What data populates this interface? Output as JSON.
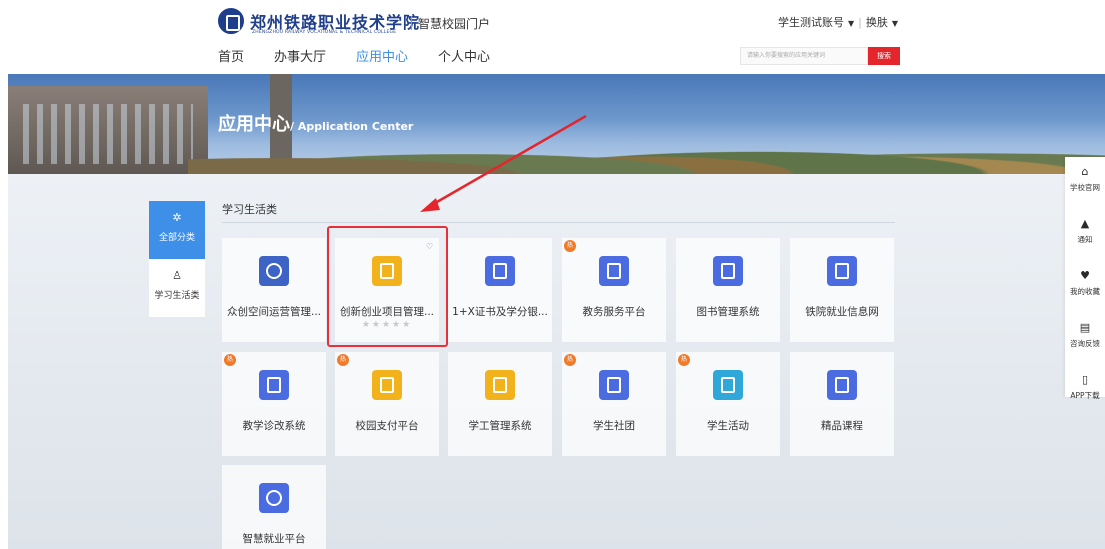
{
  "header": {
    "logo_cn": "郑州铁路职业技术学院",
    "logo_en": "ZHENGZHOU RAILWAY VOCATIONAL & TECHNICAL COLLEGE",
    "portal_name": "智慧校园门户",
    "account_label": "学生测试账号",
    "skin_label": "换肤",
    "search_placeholder": "请输入你要搜索的应用关键词",
    "search_button": "搜索"
  },
  "nav": [
    "首页",
    "办事大厅",
    "应用中心",
    "个人中心"
  ],
  "banner": {
    "title_cn": "应用中心",
    "title_en": "/ Application Center"
  },
  "categories": [
    {
      "label": "全部分类",
      "icon": "gear-icon",
      "active": true
    },
    {
      "label": "学习生活类",
      "icon": "person-chart-icon",
      "active": false
    }
  ],
  "section_title": "学习生活类",
  "apps": [
    {
      "name": "众创空间运营管理...",
      "icon": "person-globe-icon",
      "color": "#3d64c4",
      "hot": false
    },
    {
      "name": "创新创业项目管理...",
      "icon": "rocket-p-icon",
      "color": "#f2b21b",
      "hot": false,
      "favorite": true,
      "rating": "★★★★★"
    },
    {
      "name": "1+X证书及学分银...",
      "icon": "document-icon",
      "color": "#4a6ce0",
      "hot": false
    },
    {
      "name": "教务服务平台",
      "icon": "monitor-icon",
      "color": "#4a6ce0",
      "hot": true
    },
    {
      "name": "图书管理系统",
      "icon": "book-icon",
      "color": "#4a6ce0",
      "hot": false
    },
    {
      "name": "铁院就业信息网",
      "icon": "stack-icon",
      "color": "#4a6ce0",
      "hot": false
    },
    {
      "name": "教学诊改系统",
      "icon": "form-icon",
      "color": "#4a6ce0",
      "hot": true
    },
    {
      "name": "校园支付平台",
      "icon": "payment-icon",
      "color": "#f2b21b",
      "hot": true
    },
    {
      "name": "学工管理系统",
      "icon": "graduation-cap-icon",
      "color": "#f2b21b",
      "hot": false
    },
    {
      "name": "学生社团",
      "icon": "people-icon",
      "color": "#4a6ce0",
      "hot": true
    },
    {
      "name": "学生活动",
      "icon": "star-frame-icon",
      "color": "#2fa7d8",
      "hot": true
    },
    {
      "name": "精品课程",
      "icon": "clipboard-icon",
      "color": "#4a6ce0",
      "hot": false
    },
    {
      "name": "智慧就业平台",
      "icon": "headset-icon",
      "color": "#4a6ce0",
      "hot": false
    }
  ],
  "hot_badge_text": "热",
  "side_tools": [
    {
      "label": "学校官网",
      "icon": "home-icon"
    },
    {
      "label": "通知",
      "icon": "bell-icon"
    },
    {
      "label": "我的收藏",
      "icon": "heart-icon"
    },
    {
      "label": "咨询反馈",
      "icon": "feedback-icon"
    },
    {
      "label": "APP下载",
      "icon": "phone-icon"
    }
  ]
}
